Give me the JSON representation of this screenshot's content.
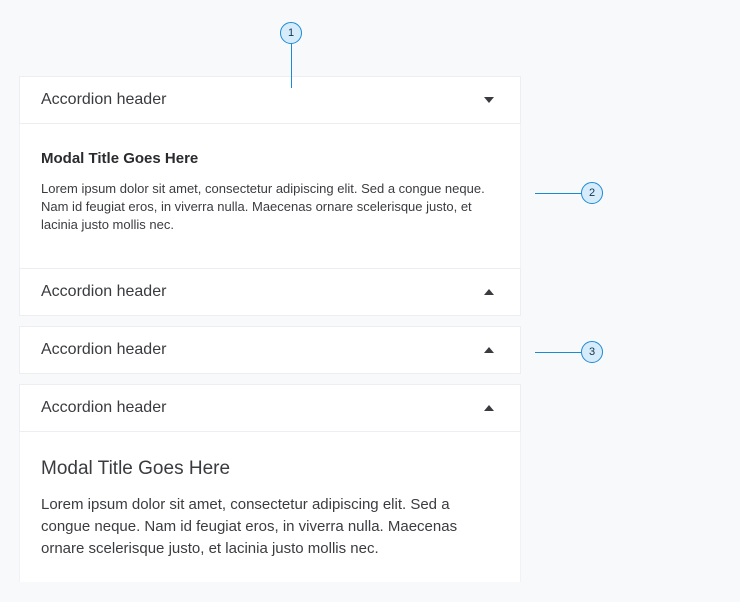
{
  "accordion": {
    "sections": [
      {
        "header": "Accordion header",
        "expanded": true,
        "content_title": "Modal Title Goes Here",
        "content_text": "Lorem ipsum dolor sit amet, consectetur adipiscing elit. Sed a congue neque. Nam id feugiat eros, in viverra nulla. Maecenas ornare scelerisque justo, et lacinia justo mollis nec."
      },
      {
        "header": "Accordion header",
        "expanded": false
      },
      {
        "header": "Accordion header",
        "expanded": false
      },
      {
        "header": "Accordion header",
        "expanded": true,
        "content_title": "Modal Title Goes Here",
        "content_text": "Lorem ipsum dolor sit amet, consectetur adipiscing elit. Sed a congue neque. Nam id feugiat eros, in viverra nulla. Maecenas ornare scelerisque justo, et lacinia justo mollis nec."
      }
    ]
  },
  "callouts": [
    "1",
    "2",
    "3"
  ],
  "colors": {
    "background": "#f8f9fb",
    "panel": "#ffffff",
    "callout_border": "#1a8ad6",
    "callout_fill": "#d7ecfb"
  }
}
